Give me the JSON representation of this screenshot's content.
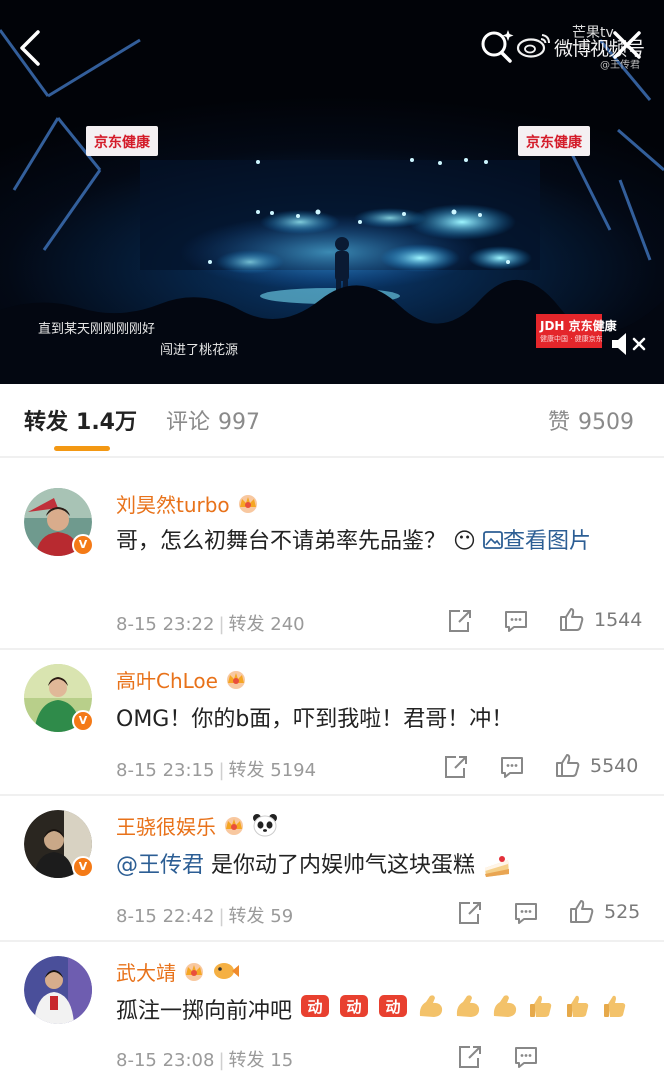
{
  "video": {
    "banner_text": "京东健康",
    "lyric_line_1": "直到某天刚刚刚刚好",
    "lyric_line_2": "闯进了桃花源",
    "sponsor_name": "JDH 京东健康",
    "sponsor_tag": "健康中国 · 健康京东",
    "watermark_brand": "芒果tv",
    "watermark_text": "微博视频号",
    "watermark_handle": "@王传君"
  },
  "tabs": [
    {
      "label": "转发",
      "count": "1.4万"
    },
    {
      "label": "评论",
      "count": "997"
    },
    {
      "label": "赞",
      "count": "9509"
    }
  ],
  "reposts": [
    {
      "user": "刘昊然turbo",
      "text": "哥，怎么初舞台不请弟率先品鉴？",
      "emoji": "😶",
      "link": "查看图片",
      "time": "8-15 23:22",
      "repost_label": "转发",
      "repost_count": "240",
      "likes": "1544"
    },
    {
      "user": "高叶ChLoe",
      "text": "OMG！你的b面，吓到我啦！君哥！冲！",
      "time": "8-15 23:15",
      "repost_label": "转发",
      "repost_count": "5194",
      "likes": "5540"
    },
    {
      "user": "王骁很娱乐",
      "mention": "@王传君",
      "text": " 是你动了内娱帅气这块蛋糕",
      "time": "8-15 22:42",
      "repost_label": "转发",
      "repost_count": "59",
      "likes": "525"
    },
    {
      "user": "武大靖",
      "text": "孤注一掷向前冲吧",
      "emoji_sticker": "动",
      "time": "8-15 23:08",
      "repost_label": "转发",
      "repost_count": "15"
    }
  ],
  "colors": {
    "username": "#e8721a",
    "link": "#2c5e94",
    "tab_indicator": "#f39813",
    "verified_badge": "#f47a17"
  }
}
